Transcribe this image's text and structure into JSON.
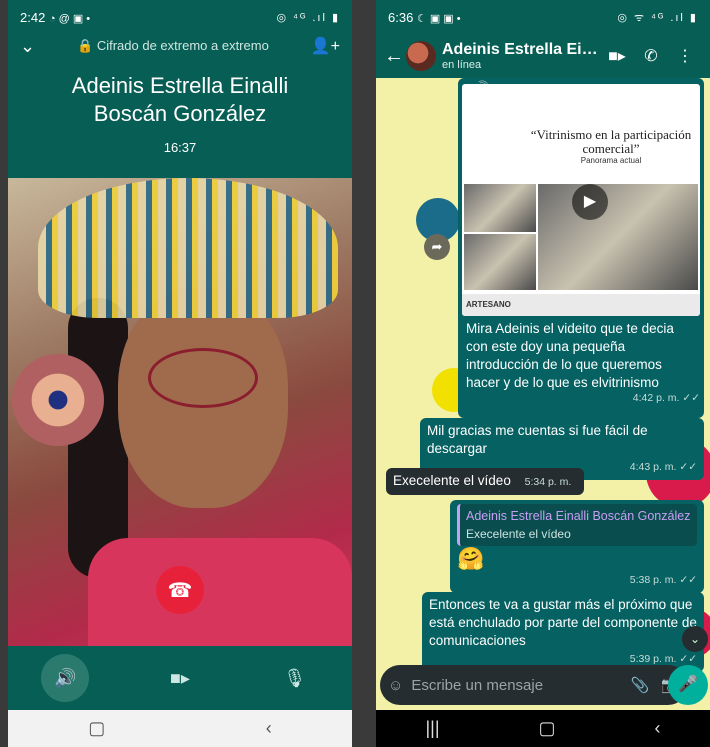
{
  "call": {
    "status": {
      "time": "2:42",
      "icons": "◔ @ ▣ •",
      "right": "◎ ⁴ᴳ .ıl ▮"
    },
    "encryption": "🔒 Cifrado de extremo a extremo",
    "name_line1": "Adeinis Estrella Einalli",
    "name_line2": "Boscán González",
    "timer": "16:37",
    "icons": {
      "collapse": "chevron-down",
      "add": "add-participant",
      "speaker": "speaker",
      "video": "video",
      "mute": "mute-mic",
      "hangup": "hangup"
    }
  },
  "chat": {
    "status": {
      "time": "6:36",
      "icons": "☾ ▣ ▣ •",
      "right": "◎ ᯤ ⁴ᴳ .ıl ▮"
    },
    "title": "Adeinis Estrella Einalli Boscán González",
    "title_display": "Adeinis Estrella Einalli...",
    "subtitle": "en línea",
    "video_msg": {
      "poster_title": "“Vitrinismo en la participación comercial”",
      "poster_sub": "Panorama actual",
      "footer": "ARTESANO",
      "caption": "Mira Adeinis el videito que te decia con este doy una pequeña introducción de lo que queremos hacer y de lo que es elvitrinismo",
      "time": "4:42 p. m. ✓✓"
    },
    "messages": [
      {
        "text": "Mil gracias me cuentas si fue fácil de descargar",
        "time": "4:43 p. m. ✓✓"
      },
      {
        "text": "Execelente el vídeo",
        "time": "5:34 p. m."
      },
      {
        "quote_name": "Adeinis Estrella Einalli Boscán González",
        "quote_text": "Execelente el vídeo",
        "text": "🤗",
        "time": "5:38 p. m. ✓✓"
      },
      {
        "text": "Entonces te va a gustar más el próximo que está enchulado por parte del componente de comunicaciones",
        "time": "5:39 p. m. ✓✓"
      }
    ],
    "composer_placeholder": "Escribe un mensaje"
  },
  "colors": {
    "header": "#075e54",
    "outgoing": "#056162",
    "incoming": "#262d31",
    "hangup": "#e8213a",
    "mic": "#00af9c"
  }
}
